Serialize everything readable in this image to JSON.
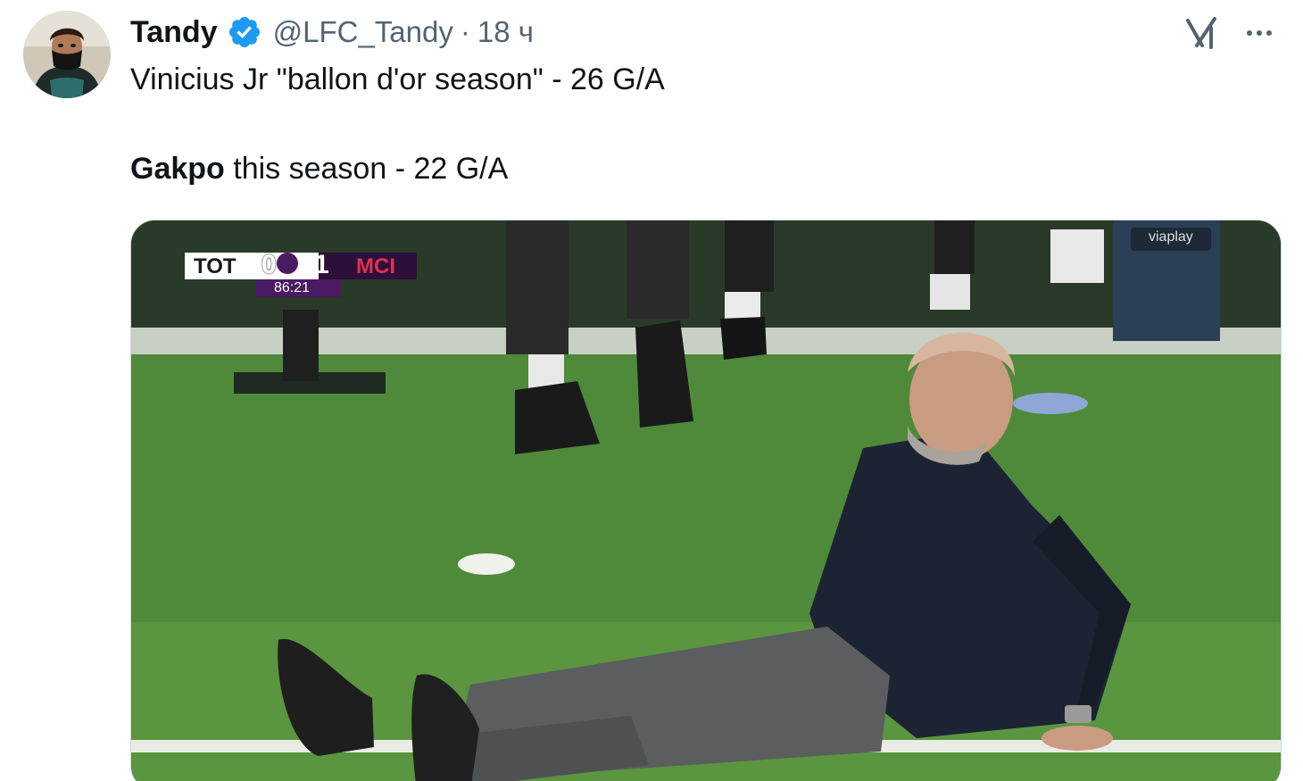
{
  "tweet": {
    "author": {
      "display_name": "Tandy",
      "handle": "@LFC_Tandy",
      "separator": "·",
      "time": "18 ч",
      "verified": true,
      "avatar_icon": "profile-avatar"
    },
    "text": {
      "line1": "Vinicius Jr \"ballon d'or season\" - 26 G/A",
      "line2_bold": "Gakpo",
      "line2_rest": " this season - 22 G/A"
    },
    "actions": {
      "grok_icon": "grok-icon",
      "more_icon": "more-icon"
    },
    "media": {
      "scoreboard": {
        "home": "TOT",
        "home_score": "0",
        "away_score": "1",
        "away": "MCI",
        "clock": "86:21"
      },
      "broadcaster": "viaplay"
    }
  },
  "colors": {
    "text_primary": "#0f1419",
    "text_secondary": "#536471",
    "verified_blue": "#1d9bf0",
    "pitch_green": "#3f6f32"
  }
}
